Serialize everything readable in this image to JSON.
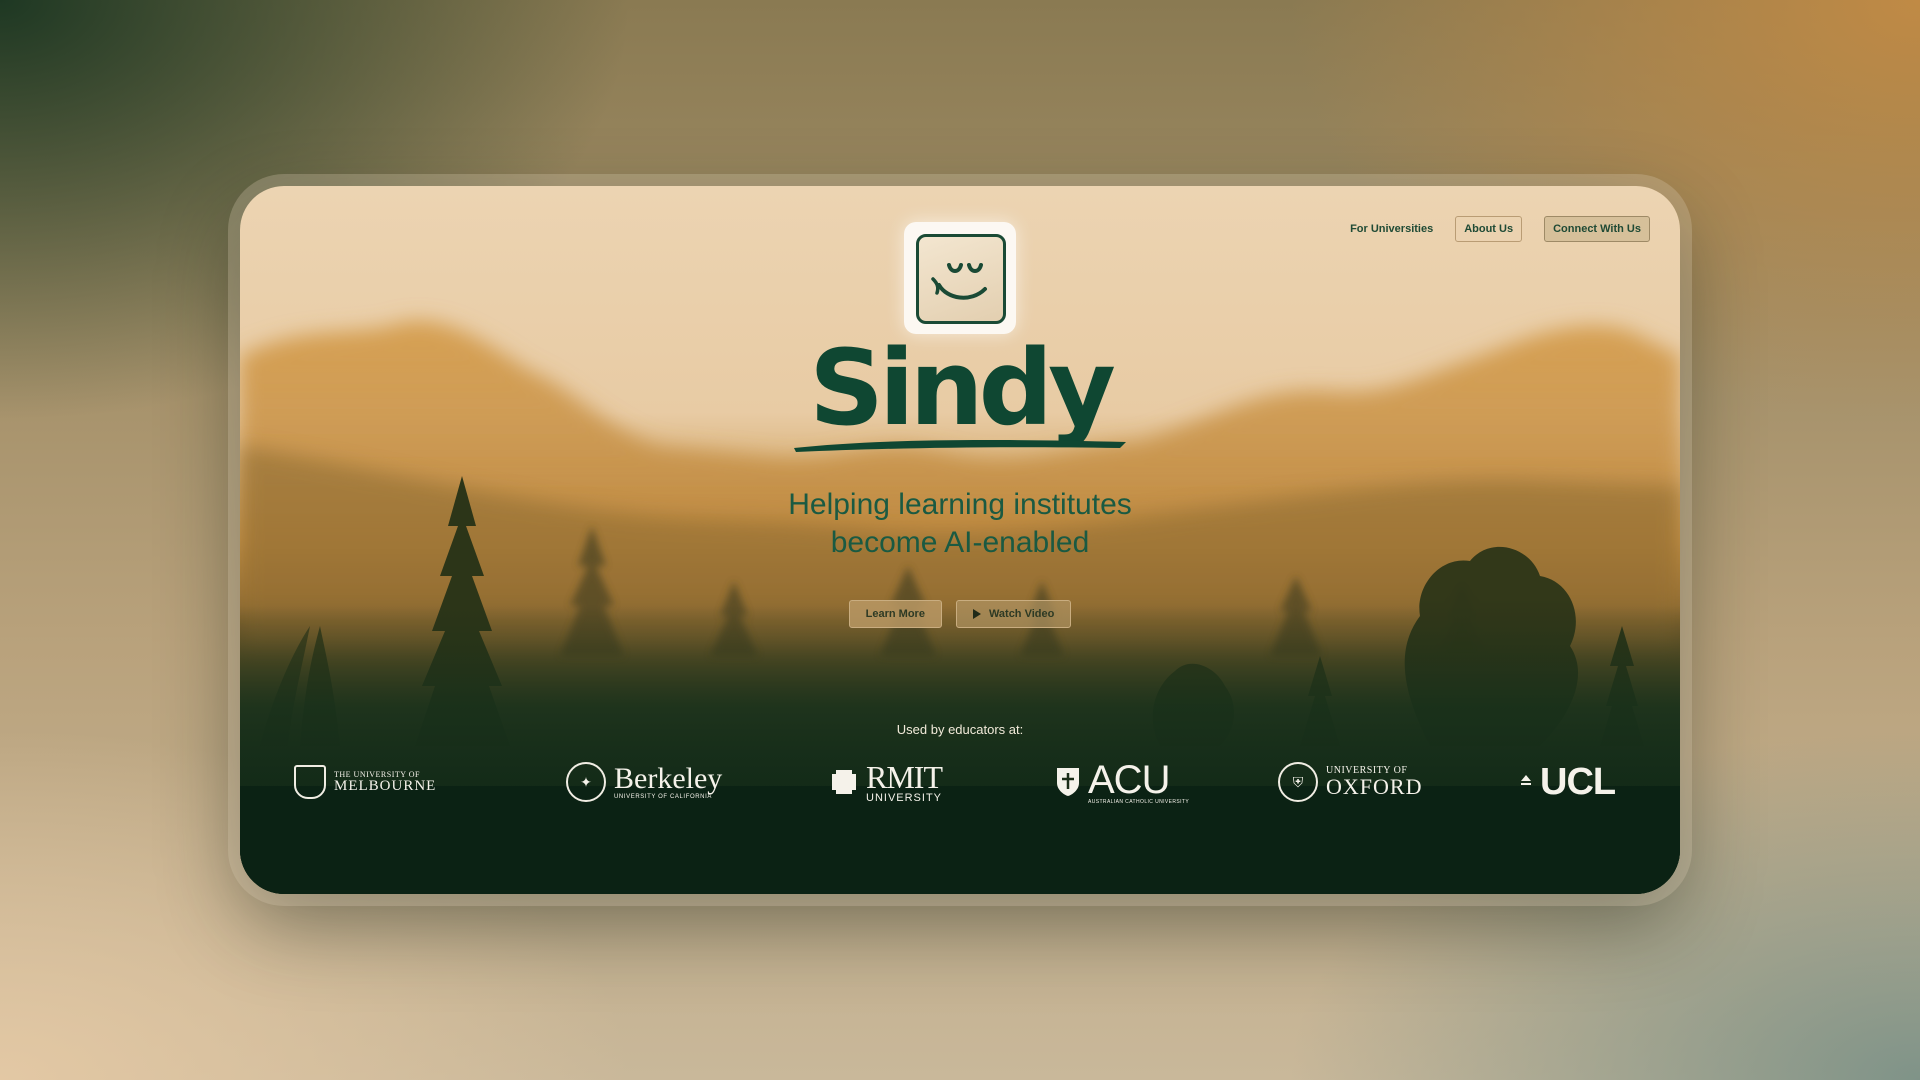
{
  "brand": {
    "name": "Sindy",
    "tagline_line1": "Helping learning institutes",
    "tagline_line2": "become AI-enabled",
    "logo_icon": "smiling-face-icon",
    "primary_color": "#0f4732"
  },
  "nav": {
    "for_universities": "For Universities",
    "about_us": "About Us",
    "connect": "Connect With Us"
  },
  "hero": {
    "learn_more": "Learn More",
    "watch_video": "Watch Video",
    "play_icon": "play-icon"
  },
  "partners": {
    "heading": "Used by educators at:",
    "melbourne": {
      "top": "THE UNIVERSITY OF",
      "name": "MELBOURNE"
    },
    "berkeley": {
      "name": "Berkeley",
      "sub": "UNIVERSITY OF CALIFORNIA"
    },
    "rmit": {
      "name": "RMIT",
      "sub": "UNIVERSITY"
    },
    "acu": {
      "name": "ACU",
      "sub": "AUSTRALIAN CATHOLIC UNIVERSITY"
    },
    "oxford": {
      "top": "UNIVERSITY OF",
      "name": "OXFORD"
    },
    "ucl": {
      "name": "UCL"
    }
  }
}
